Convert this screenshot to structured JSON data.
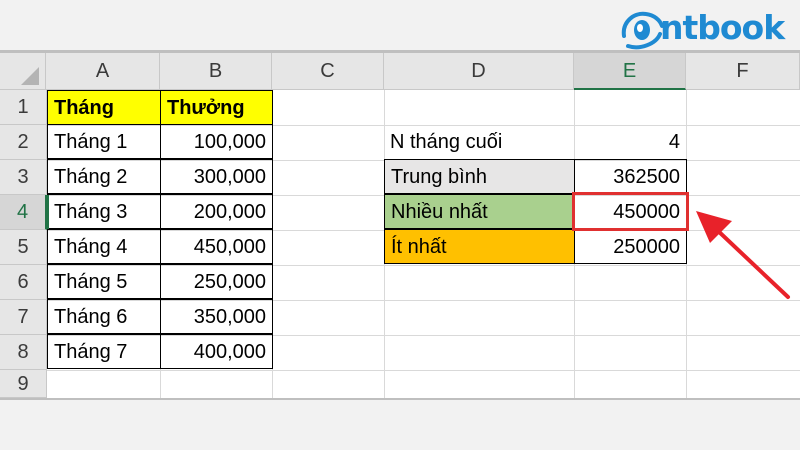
{
  "logo": {
    "text": "ntbook"
  },
  "colors": {
    "yellow": "#ffff00",
    "gray": "#e7e6e6",
    "green": "#a9d08e",
    "orange": "#ffc000",
    "red_highlight": "#e03030",
    "arrow": "#e8222a"
  },
  "columns": [
    "A",
    "B",
    "C",
    "D",
    "E",
    "F"
  ],
  "rows": [
    "1",
    "2",
    "3",
    "4",
    "5",
    "6",
    "7",
    "8",
    "9"
  ],
  "table": {
    "header_month": "Tháng",
    "header_bonus": "Thưởng",
    "months": [
      "Tháng 1",
      "Tháng 2",
      "Tháng 3",
      "Tháng 4",
      "Tháng 5",
      "Tháng 6",
      "Tháng 7"
    ],
    "bonuses": [
      "100,000",
      "300,000",
      "200,000",
      "450,000",
      "250,000",
      "350,000",
      "400,000"
    ]
  },
  "summary": {
    "n_label": "N tháng cuối",
    "n_value": "4",
    "avg_label": "Trung bình",
    "avg_value": "362500",
    "max_label": "Nhiều nhất",
    "max_value": "450000",
    "min_label": "Ít nhất",
    "min_value": "250000"
  },
  "selected_cell": "E4"
}
